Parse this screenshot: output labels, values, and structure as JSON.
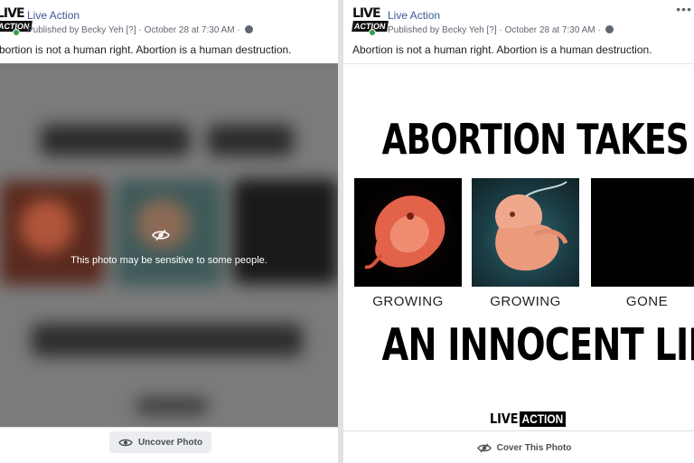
{
  "post": {
    "page_name": "Live Action",
    "published_by": "Published by Becky Yeh",
    "help_marker": "[?]",
    "timestamp": "October 28 at 7:30 AM",
    "separator": "·",
    "caption_left": "bortion is not a human right. Abortion is a human destruction.",
    "caption_right": "Abortion is not a human right. Abortion is a human destruction.",
    "more_label": "•••"
  },
  "avatar": {
    "logo_top": "LIVE",
    "logo_bottom": "ACTION"
  },
  "left": {
    "sensitive_text": "This photo may be sensitive to some people.",
    "uncover_label": "Uncover Photo"
  },
  "right": {
    "headline_top": "ABORTION TAKES",
    "headline_bottom": "AN INNOCENT LIFE",
    "labels": [
      "GROWING",
      "GROWING",
      "GONE"
    ],
    "brand_live": "LIVE",
    "brand_action": "ACTION",
    "cover_label": "Cover This Photo"
  },
  "colors": {
    "link_blue": "#385898",
    "online_green": "#31a24c",
    "meta_gray": "#606770",
    "button_bg": "#ebedf0",
    "overlay_gray": "#7b7b7b"
  },
  "icons": [
    "eye-slash-icon",
    "eye-icon",
    "globe-icon",
    "more-icon"
  ]
}
